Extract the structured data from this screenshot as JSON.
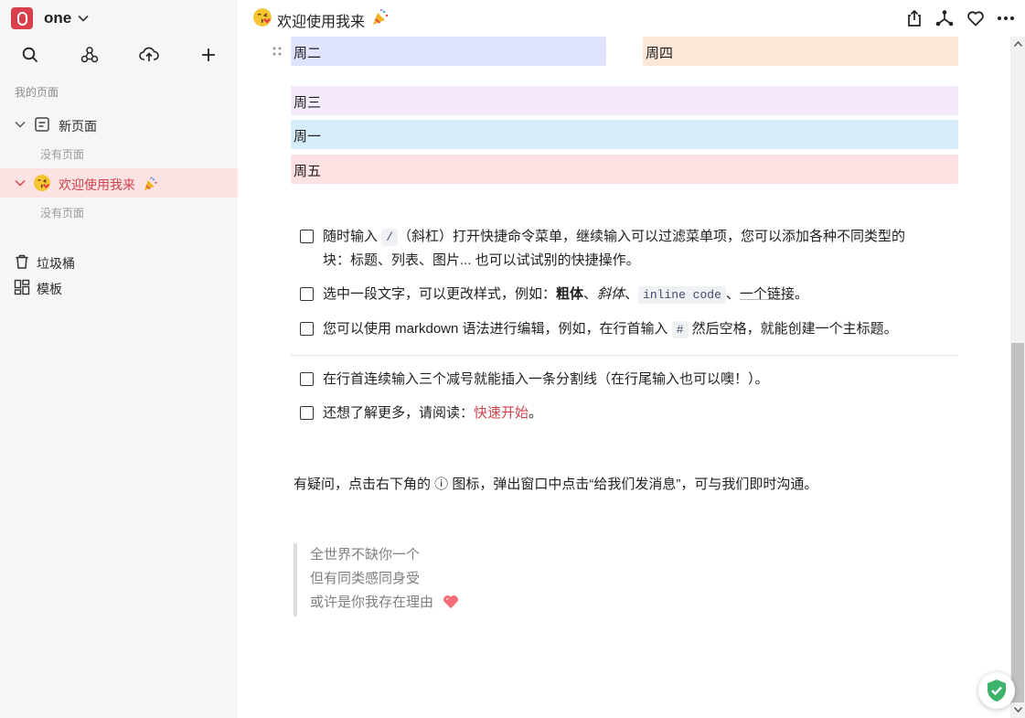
{
  "workspace": {
    "name": "one"
  },
  "sidebar": {
    "section_title": "我的页面",
    "pages": [
      {
        "label": "新页面",
        "empty_note": "没有页面"
      },
      {
        "label": "欢迎使用我来",
        "empty_note": "没有页面"
      }
    ],
    "links": [
      {
        "label": "垃圾桶",
        "icon": "trash-icon"
      },
      {
        "label": "模板",
        "icon": "template-icon"
      }
    ]
  },
  "header": {
    "title": "欢迎使用我来"
  },
  "content": {
    "days": [
      "周二",
      "周四",
      "周三",
      "周一",
      "周五"
    ],
    "todos": {
      "t1": {
        "a": "随时输入 ",
        "code": "/",
        "b": "（斜杠）打开快捷命令菜单，继续输入可以过滤菜单项，您可以添加各种不同类型的",
        "line2": "块：标题、列表、图片... 也可以试试别的快捷操作。"
      },
      "t2": {
        "a": "选中一段文字，可以更改样式，例如：",
        "bold": "粗体",
        "sep1": "、",
        "italic": "斜体",
        "sep2": "、",
        "code": "inline code",
        "sep3": "、",
        "underline": "一个链接",
        "end": "。"
      },
      "t3": {
        "a": "您可以使用 markdown 语法进行编辑，例如，在行首输入 ",
        "code": "#",
        "b": " 然后空格，就能创建一个主标题。"
      },
      "t4": {
        "a": "在行首连续输入三个减号就能插入一条分割线（在行尾输入也可以噢！）。"
      },
      "t5": {
        "a": "还想了解更多，请阅读：",
        "link": "快速开始",
        "end": "。"
      }
    },
    "note": "有疑问，点击右下角的 ⓘ 图标，弹出窗口中点击“给我们发消息”，可与我们即时沟通。",
    "quote": [
      "全世界不缺你一个",
      "但有同类感同身受",
      "或许是你我存在理由"
    ]
  },
  "colors": {
    "brand": "#d9404b",
    "active_row": "#fbe3e4",
    "tue": "#dfe3fd",
    "thu": "#fbe8d9",
    "wed": "#f5eafb",
    "mon": "#d6edfa",
    "fri": "#fde1e3",
    "shield": "#3bb36a"
  }
}
